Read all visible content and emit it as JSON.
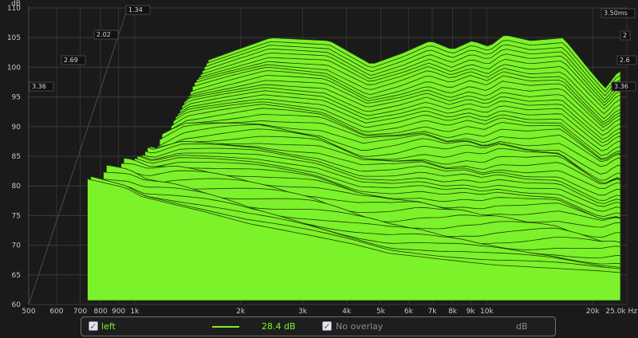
{
  "chart_data": {
    "type": "area",
    "subtype": "waterfall-3d",
    "y_unit_label": "dB",
    "x_unit_label": "Hz",
    "ylim": [
      60,
      110
    ],
    "y_ticks": [
      "60",
      "65",
      "70",
      "75",
      "80",
      "85",
      "90",
      "95",
      "100",
      "105",
      "110"
    ],
    "x_scale": "log",
    "xlim": [
      500,
      25000
    ],
    "x_ticks": [
      {
        "v": 500,
        "label": "500"
      },
      {
        "v": 600,
        "label": "600"
      },
      {
        "v": 700,
        "label": "700"
      },
      {
        "v": 800,
        "label": "800"
      },
      {
        "v": 900,
        "label": "900"
      },
      {
        "v": 1000,
        "label": "1k"
      },
      {
        "v": 2000,
        "label": "2k"
      },
      {
        "v": 3000,
        "label": "3k"
      },
      {
        "v": 4000,
        "label": "4k"
      },
      {
        "v": 5000,
        "label": "5k"
      },
      {
        "v": 6000,
        "label": "6k"
      },
      {
        "v": 7000,
        "label": "7k"
      },
      {
        "v": 8000,
        "label": "8k"
      },
      {
        "v": 9000,
        "label": "9k"
      },
      {
        "v": 10000,
        "label": "10k"
      },
      {
        "v": 20000,
        "label": "20k"
      },
      {
        "v": 25000,
        "label": "25.0k Hz"
      }
    ],
    "z_axis_left_labels": [
      "3.36",
      "2.69",
      "2.02",
      "1.34"
    ],
    "z_axis_right_labels": [
      "3.50ms",
      "2",
      "2.6",
      "3.36"
    ],
    "fill_color": "#7cf22a",
    "line_color": "#1e3a08",
    "grid": true,
    "slice_count": 50,
    "slice_time_range_ms": [
      0,
      3.5
    ],
    "front_slice_db": [
      {
        "f": 700,
        "db": 80.5
      },
      {
        "f": 900,
        "db": 79
      },
      {
        "f": 1000,
        "db": 77.5
      },
      {
        "f": 1500,
        "db": 75
      },
      {
        "f": 2000,
        "db": 73
      },
      {
        "f": 3000,
        "db": 71
      },
      {
        "f": 4000,
        "db": 69.5
      },
      {
        "f": 5000,
        "db": 68
      },
      {
        "f": 7000,
        "db": 67
      },
      {
        "f": 10000,
        "db": 66
      },
      {
        "f": 20000,
        "db": 65
      },
      {
        "f": 25000,
        "db": 64.5
      }
    ],
    "back_slice_db": [
      {
        "f": 1000,
        "db": 94
      },
      {
        "f": 1200,
        "db": 99
      },
      {
        "f": 1500,
        "db": 101
      },
      {
        "f": 2000,
        "db": 103.5
      },
      {
        "f": 3000,
        "db": 103
      },
      {
        "f": 4000,
        "db": 99
      },
      {
        "f": 5000,
        "db": 101
      },
      {
        "f": 6000,
        "db": 103
      },
      {
        "f": 7000,
        "db": 101.5
      },
      {
        "f": 8000,
        "db": 103
      },
      {
        "f": 9000,
        "db": 102
      },
      {
        "f": 10000,
        "db": 104
      },
      {
        "f": 12000,
        "db": 103
      },
      {
        "f": 15000,
        "db": 103.5
      },
      {
        "f": 18000,
        "db": 98
      },
      {
        "f": 20000,
        "db": 95
      },
      {
        "f": 22000,
        "db": 98
      },
      {
        "f": 25000,
        "db": 97
      }
    ]
  },
  "legend": {
    "series_checked": true,
    "series_label": "left",
    "series_value": "28.4 dB",
    "overlay_checked": true,
    "overlay_label": "No overlay",
    "unit": "dB"
  }
}
